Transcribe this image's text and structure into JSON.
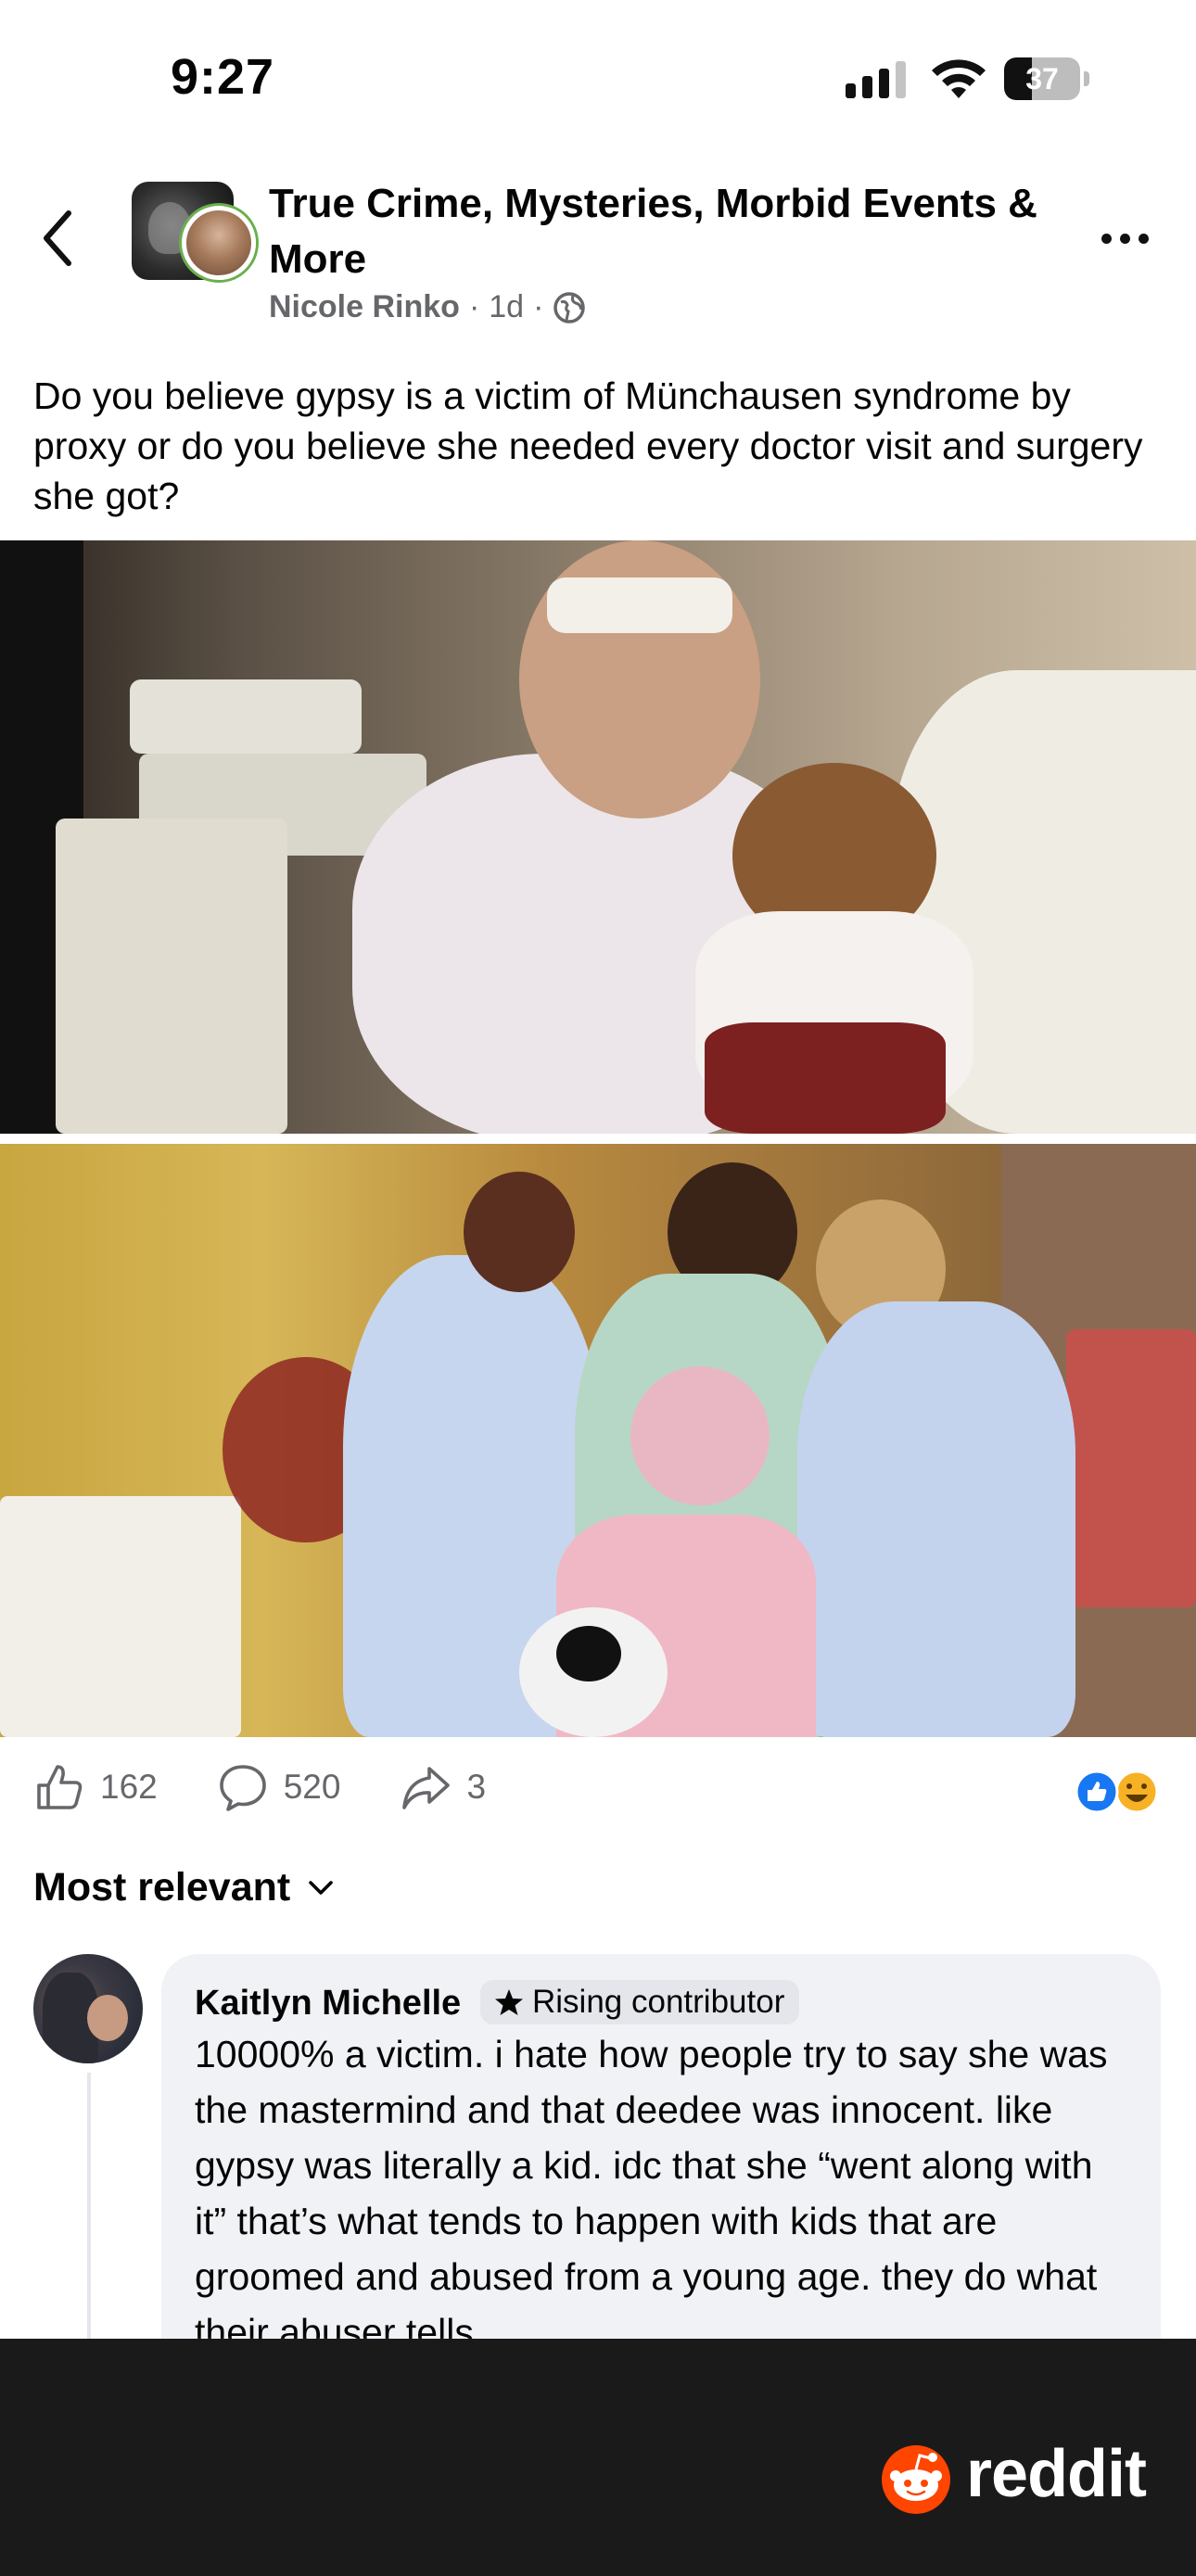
{
  "status_bar": {
    "time": "9:27",
    "battery": "37",
    "battery_level": 0.37
  },
  "header": {
    "group_name": "True Crime, Mysteries, Morbid Events & More",
    "author": "Nicole Rinko",
    "time_ago": "1d",
    "separator": "·"
  },
  "post": {
    "text": "Do you believe gypsy is a victim of Münchausen syndrome by proxy or do you believe she needed every doctor visit and surgery she got?"
  },
  "actions": {
    "likes": "162",
    "comments": "520",
    "shares": "3"
  },
  "comments_section": {
    "sort_label": "Most relevant"
  },
  "comment": {
    "author": "Kaitlyn Michelle",
    "badge": "Rising contributor",
    "text": "10000% a victim. i hate how people try to say she was the mastermind and that deedee was innocent. like gypsy was literally a kid. idc that she “went along with it” that’s what tends to happen with kids that are groomed and abused from a young age. they do what their abuser tells"
  },
  "footer": {
    "brand": "reddit"
  },
  "colors": {
    "accent_blue": "#1877f2",
    "reddit_orange": "#ff4500",
    "footer_bg": "#1a1a1b"
  }
}
